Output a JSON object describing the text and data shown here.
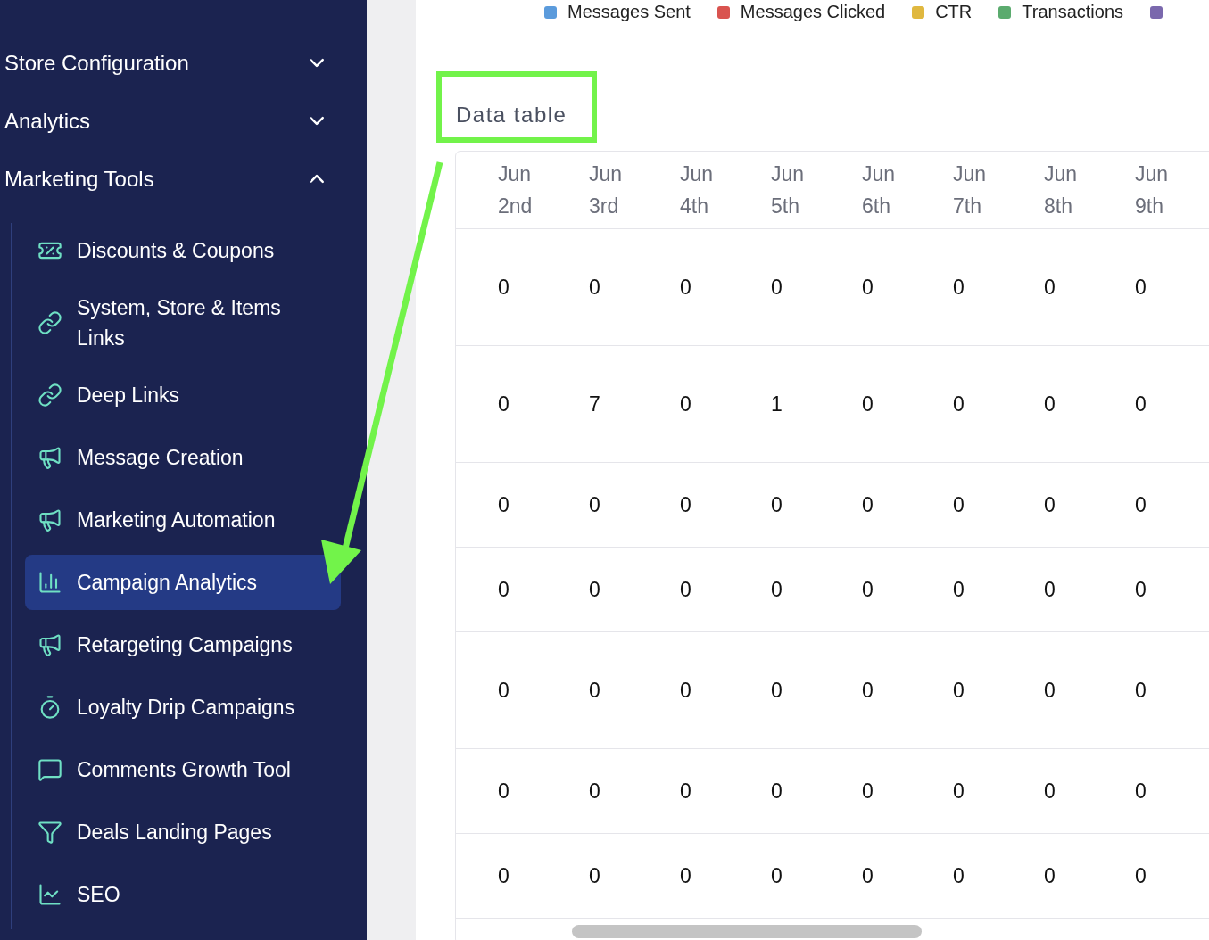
{
  "sidebar": {
    "sections": [
      {
        "label": "Store Configuration",
        "expanded": false
      },
      {
        "label": "Analytics",
        "expanded": false
      },
      {
        "label": "Marketing Tools",
        "expanded": true,
        "items": [
          {
            "label": "Discounts & Coupons",
            "selected": false
          },
          {
            "label": "System, Store & Items Links",
            "selected": false
          },
          {
            "label": "Deep Links",
            "selected": false
          },
          {
            "label": "Message Creation",
            "selected": false
          },
          {
            "label": "Marketing Automation",
            "selected": false
          },
          {
            "label": "Campaign Analytics",
            "selected": true
          },
          {
            "label": "Retargeting Campaigns",
            "selected": false
          },
          {
            "label": "Loyalty Drip Campaigns",
            "selected": false
          },
          {
            "label": "Comments Growth Tool",
            "selected": false
          },
          {
            "label": "Deals Landing Pages",
            "selected": false
          },
          {
            "label": "SEO",
            "selected": false
          }
        ]
      }
    ]
  },
  "legend": [
    {
      "label": "Messages Sent",
      "color": "#5b9bdc"
    },
    {
      "label": "Messages Clicked",
      "color": "#d9534f"
    },
    {
      "label": "CTR",
      "color": "#e0b83f"
    },
    {
      "label": "Transactions",
      "color": "#5bab6e"
    },
    {
      "color": "#7a68ad"
    }
  ],
  "data_table": {
    "title": "Data table",
    "columns": [
      "Jun 2nd",
      "Jun 3rd",
      "Jun 4th",
      "Jun 5th",
      "Jun 6th",
      "Jun 7th",
      "Jun 8th",
      "Jun 9th"
    ],
    "rows": [
      {
        "kind": "tall",
        "cells": [
          "0",
          "0",
          "0",
          "0",
          "0",
          "0",
          "0",
          "0"
        ]
      },
      {
        "kind": "tall",
        "cells": [
          "0",
          "7",
          "0",
          "1",
          "0",
          "0",
          "0",
          "0"
        ]
      },
      {
        "kind": "short",
        "cells": [
          "0",
          "0",
          "0",
          "0",
          "0",
          "0",
          "0",
          "0"
        ]
      },
      {
        "kind": "short",
        "cells": [
          "0",
          "0",
          "0",
          "0",
          "0",
          "0",
          "0",
          "0"
        ]
      },
      {
        "kind": "tall",
        "cells": [
          "0",
          "0",
          "0",
          "0",
          "0",
          "0",
          "0",
          "0"
        ]
      },
      {
        "kind": "short",
        "cells": [
          "0",
          "0",
          "0",
          "0",
          "0",
          "0",
          "0",
          "0"
        ]
      },
      {
        "kind": "short",
        "cells": [
          "0",
          "0",
          "0",
          "0",
          "0",
          "0",
          "0",
          "0"
        ]
      }
    ]
  }
}
